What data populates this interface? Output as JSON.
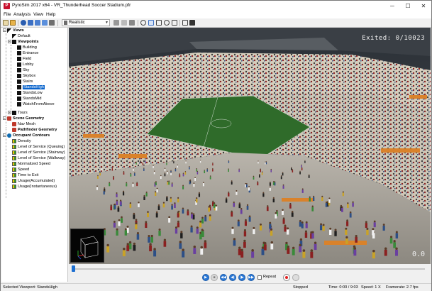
{
  "window": {
    "title": "PyroSim 2017 x64 - VR_Thunderhead Soccer Stadium.pfr",
    "app_icon_letter": "P",
    "min_label": "─",
    "max_label": "☐",
    "close_label": "✕"
  },
  "menu": [
    "File",
    "Analysis",
    "View",
    "Help"
  ],
  "toolbar": {
    "render_mode": "Realistic"
  },
  "tree": {
    "views_label": "Views",
    "default_label": "Default",
    "viewpoints_label": "Viewpoints",
    "viewpoints": [
      "Building",
      "Entrance",
      "Field",
      "Lobby",
      "Sky",
      "Skybox",
      "Stairs",
      "StandsHigh",
      "StandsLow",
      "StandsMid",
      "WatchFromAbove"
    ],
    "selected_viewpoint": "StandsHigh",
    "tours_label": "Tours",
    "scene_geometry_label": "Scene Geometry",
    "nav_mesh_label": "Nav Mesh",
    "pathfinder_geometry_label": "Pathfinder Geometry",
    "occupant_contours_label": "Occupant Contours",
    "contours": [
      "Density",
      "Level of Service (Queuing)",
      "Level of Service (Stairway)",
      "Level of Service (Walkway)",
      "Normalized Speed",
      "Speed",
      "Time to Exit",
      "Usage(Accumulated)",
      "Usage(Instantaneous)"
    ]
  },
  "viewport": {
    "exited_text": "Exited:     0/10023",
    "clock_text": "0.0"
  },
  "playback": {
    "progress": 0.0,
    "repeat_label": "Repeat",
    "buttons": [
      "play",
      "stop",
      "rewind",
      "step-back",
      "step-forward",
      "fast-forward"
    ]
  },
  "status": {
    "selected_viewpoint": "Selected Viewport: StandsHigh",
    "state": "Stopped",
    "time": "Time: 0:00 / 9:03",
    "speed": "Speed: 1 X",
    "framerate": "Framerate: 2.7 fps"
  },
  "colors": {
    "accent": "#0a64cc",
    "field": "#2f6b2a",
    "seats": "#c9c2b0"
  }
}
